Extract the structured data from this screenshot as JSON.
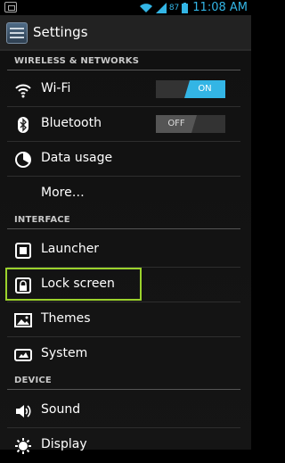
{
  "status": {
    "battery": "87",
    "time": "11:08 AM"
  },
  "header": {
    "title": "Settings"
  },
  "sections": {
    "wireless": "WIRELESS & NETWORKS",
    "interface": "INTERFACE",
    "device": "DEVICE"
  },
  "items": {
    "wifi": {
      "label": "Wi-Fi",
      "toggle": "ON",
      "icon": "wifi-icon"
    },
    "bluetooth": {
      "label": "Bluetooth",
      "toggle": "OFF",
      "icon": "bluetooth-icon"
    },
    "data_usage": {
      "label": "Data usage",
      "icon": "data-usage-icon"
    },
    "more": {
      "label": "More…"
    },
    "launcher": {
      "label": "Launcher",
      "icon": "launcher-icon"
    },
    "lock_screen": {
      "label": "Lock screen",
      "icon": "lock-icon"
    },
    "themes": {
      "label": "Themes",
      "icon": "themes-icon"
    },
    "system": {
      "label": "System",
      "icon": "system-icon"
    },
    "sound": {
      "label": "Sound",
      "icon": "sound-icon"
    },
    "display": {
      "label": "Display",
      "icon": "display-icon"
    }
  },
  "colors": {
    "accent": "#33b5e5",
    "highlight": "#9bd22c"
  }
}
